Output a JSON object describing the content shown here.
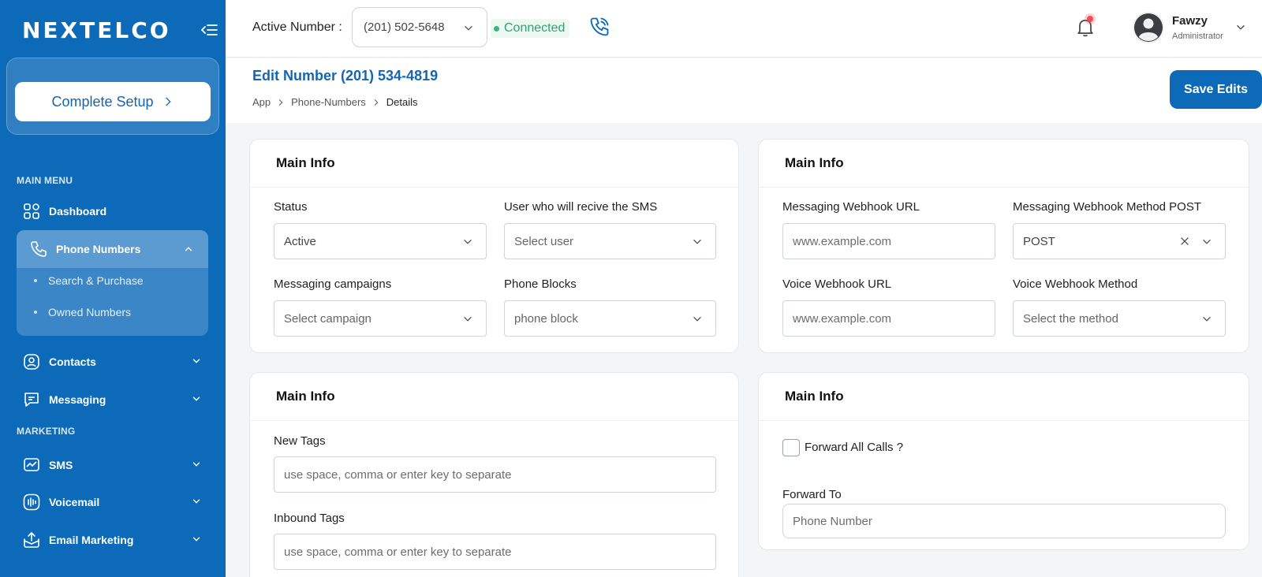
{
  "brand": {
    "logo": "NEXTELCO",
    "primary": "#0d6ab8",
    "success": "#2fa56e",
    "alert": "#ef4d5d"
  },
  "sidebar": {
    "setup_label": "Complete Setup",
    "main_menu_label": "MAIN MENU",
    "marketing_label": "MARKETING",
    "items": {
      "dashboard": "Dashboard",
      "phone_numbers": "Phone Numbers",
      "search_purchase": "Search & Purchase",
      "owned_numbers": "Owned Numbers",
      "contacts": "Contacts",
      "messaging": "Messaging",
      "sms": "SMS",
      "voicemail": "Voicemail",
      "email_marketing": "Email Marketing"
    }
  },
  "topbar": {
    "active_number_label": "Active Number :",
    "active_number_value": "(201) 502-5648",
    "status": "Connected",
    "user_name": "Fawzy",
    "user_role": "Administrator"
  },
  "header": {
    "title": "Edit Number (201) 534-4819",
    "breadcrumb": [
      "App",
      "Phone-Numbers",
      "Details"
    ],
    "save_label": "Save Edits"
  },
  "cards": {
    "main_left": {
      "title": "Main Info",
      "status_label": "Status",
      "status_value": "Active",
      "user_label": "User who will recive the SMS",
      "user_placeholder": "Select user",
      "campaigns_label": "Messaging campaigns",
      "campaigns_placeholder": "Select campaign",
      "blocks_label": "Phone Blocks",
      "blocks_placeholder": "phone block"
    },
    "main_right": {
      "title": "Main Info",
      "msg_webhook_label": "Messaging Webhook URL",
      "msg_webhook_placeholder": "www.example.com",
      "msg_method_label": "Messaging Webhook Method POST",
      "msg_method_value": "POST",
      "voice_webhook_label": "Voice Webhook URL",
      "voice_webhook_placeholder": "www.example.com",
      "voice_method_label": "Voice Webhook Method",
      "voice_method_placeholder": "Select the method"
    },
    "tags": {
      "title": "Main Info",
      "new_tags_label": "New Tags",
      "new_tags_placeholder": "use space, comma or enter key to separate",
      "inbound_tags_label": "Inbound Tags",
      "inbound_tags_placeholder": "use space, comma or enter key to separate"
    },
    "forward": {
      "title": "Main Info",
      "forward_all_label": "Forward All Calls ?",
      "forward_to_label": "Forward To",
      "forward_to_placeholder": "Phone Number"
    }
  }
}
